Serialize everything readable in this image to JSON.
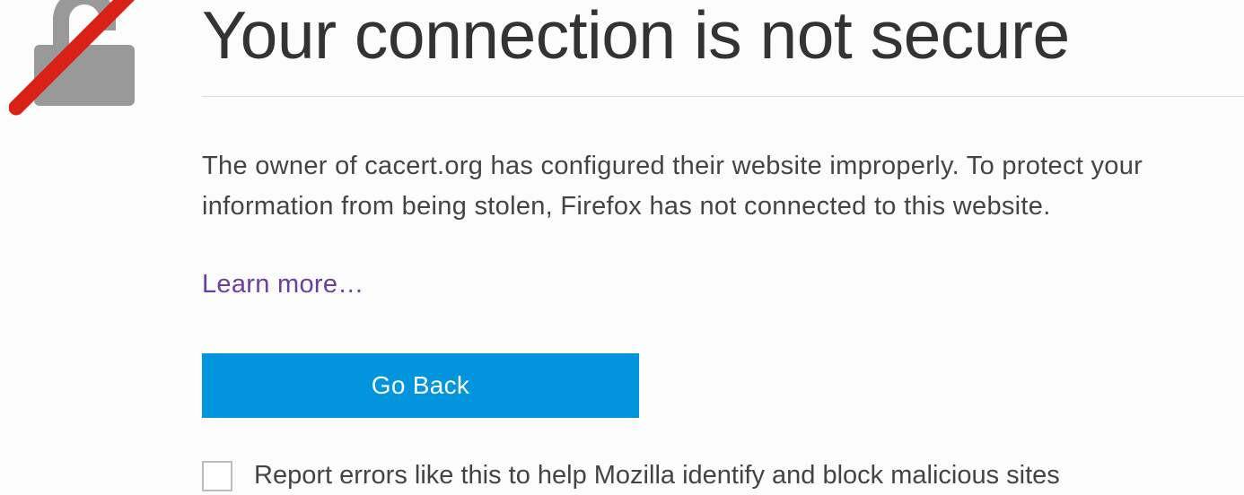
{
  "title": "Your connection is not secure",
  "description": "The owner of cacert.org has configured their website improperly. To protect your information from being stolen, Firefox has not connected to this website.",
  "learn_more_label": "Learn more…",
  "go_back_label": "Go Back",
  "report_label": "Report errors like this to help Mozilla identify and block malicious sites",
  "colors": {
    "accent": "#0095dd",
    "link_visited": "#6b3fa0",
    "lock_grey": "#999999",
    "slash_red": "#d92215"
  }
}
